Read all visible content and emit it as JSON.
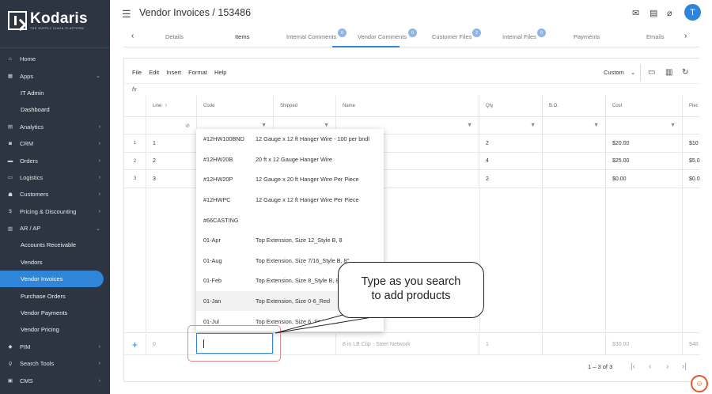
{
  "brand": {
    "name": "Kodaris",
    "tagline": "THE SUPPLY CHAIN PLATFORM"
  },
  "sidebar": {
    "items": [
      {
        "label": "Home",
        "icon": "home-icon",
        "glyph": "⌂",
        "chev": ""
      },
      {
        "label": "Apps",
        "icon": "grid-icon",
        "glyph": "▦",
        "chev": "⌄"
      },
      {
        "label": "IT Admin",
        "sub": true
      },
      {
        "label": "Dashboard",
        "sub": true
      },
      {
        "label": "Analytics",
        "icon": "chart-icon",
        "glyph": "▤",
        "chev": "›"
      },
      {
        "label": "CRM",
        "icon": "crm-icon",
        "glyph": "◙",
        "chev": "›"
      },
      {
        "label": "Orders",
        "icon": "orders-icon",
        "glyph": "▬",
        "chev": "›"
      },
      {
        "label": "Logistics",
        "icon": "truck-icon",
        "glyph": "▭",
        "chev": "›"
      },
      {
        "label": "Customers",
        "icon": "users-icon",
        "glyph": "☗",
        "chev": "›"
      },
      {
        "label": "Pricing & Discounting",
        "icon": "dollar-icon",
        "glyph": "$",
        "chev": "›"
      },
      {
        "label": "AR / AP",
        "icon": "bank-icon",
        "glyph": "▥",
        "chev": "⌄"
      },
      {
        "label": "Accounts Receivable",
        "sub": true
      },
      {
        "label": "Vendors",
        "sub": true
      },
      {
        "label": "Vendor Invoices",
        "sub": true,
        "active": true
      },
      {
        "label": "Purchase Orders",
        "sub": true
      },
      {
        "label": "Vendor Payments",
        "sub": true
      },
      {
        "label": "Vendor Pricing",
        "sub": true
      },
      {
        "label": "PIM",
        "icon": "tag-icon",
        "glyph": "◆",
        "chev": "›"
      },
      {
        "label": "Search Tools",
        "icon": "search-icon",
        "glyph": "⚲",
        "chev": "›"
      },
      {
        "label": "CMS",
        "icon": "cms-icon",
        "glyph": "▣",
        "chev": "›"
      }
    ]
  },
  "header": {
    "title": "Vendor Invoices / 153486",
    "avatar_initial": "T"
  },
  "tabs": [
    {
      "label": "Details",
      "badge": ""
    },
    {
      "label": "Items",
      "badge": "",
      "active": true
    },
    {
      "label": "Internal Comments",
      "badge": "0"
    },
    {
      "label": "Vendor Comments",
      "badge": "0"
    },
    {
      "label": "Customer Files",
      "badge": "2"
    },
    {
      "label": "Internal Files",
      "badge": "0"
    },
    {
      "label": "Payments",
      "badge": ""
    },
    {
      "label": "Emails",
      "badge": ""
    }
  ],
  "toolbar": {
    "menu": [
      "File",
      "Edit",
      "Insert",
      "Format",
      "Help"
    ],
    "view_select": "Custom",
    "fx": "fx"
  },
  "table": {
    "columns": [
      "Line",
      "Code",
      "Shipped",
      "Name",
      "Qty",
      "B.O.",
      "Cost",
      "Piec"
    ],
    "rows": [
      {
        "num": "1",
        "line": "1",
        "code": "",
        "name": "",
        "qty": "2",
        "cost": "$20.00",
        "piece": "$10"
      },
      {
        "num": "2",
        "line": "2",
        "code": "",
        "name": "",
        "qty": "4",
        "cost": "$25.00",
        "piece": "$5.0"
      },
      {
        "num": "3",
        "line": "3",
        "code": "",
        "name": "",
        "qty": "2",
        "cost": "$0.00",
        "piece": "$0.0"
      }
    ],
    "new_row": {
      "line": "0",
      "name": "8 in LB Clip - Steel Network",
      "qty": "1",
      "cost": "$30.00",
      "piece": "$48"
    }
  },
  "dropdown": [
    {
      "code": "#12HW100BND",
      "name": "12 Gauge x 12 ft Hanger Wire - 100 per bndl"
    },
    {
      "code": "#12HW20B",
      "name": "20 ft x 12 Gauge Hanger Wire"
    },
    {
      "code": "#12HW20P",
      "name": "12 Gauge x 20 ft Hanger Wire Per Piece"
    },
    {
      "code": "#12HWPC",
      "name": "12 Gauge x 12 ft Hanger Wire Per Piece"
    },
    {
      "code": "#66CASTING",
      "name": ""
    },
    {
      "code": "01-Apr",
      "name": "Top Extension, Size 12_Style B, 8"
    },
    {
      "code": "01-Aug",
      "name": "Top Extension, Size 7/16_Style B, 8\""
    },
    {
      "code": "01-Feb",
      "name": "Top Extension, Size 8_Style B, 8\""
    },
    {
      "code": "01-Jan",
      "name": "Top Extension, Size 0-6_Red",
      "highlight": true
    },
    {
      "code": "01-Jul",
      "name": "Top Extension, Size 6_Style B, 8\""
    }
  ],
  "callout": {
    "line1": "Type as you search",
    "line2": "to add products"
  },
  "pager": {
    "range": "1 – 3 of 3"
  }
}
